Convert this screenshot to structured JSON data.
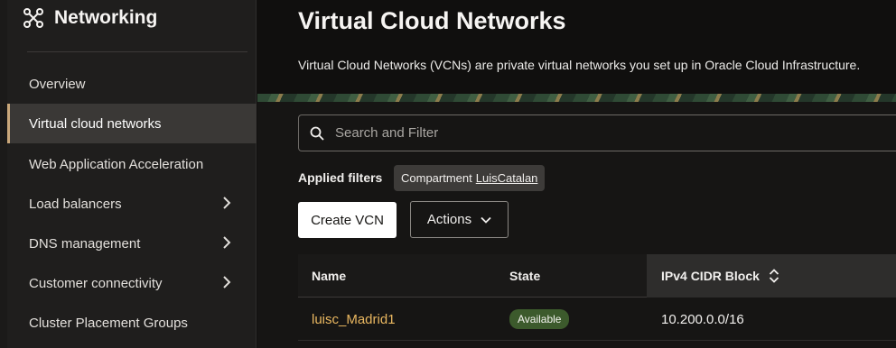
{
  "sidebar": {
    "title": "Networking",
    "items": [
      {
        "label": "Overview",
        "chevron": false,
        "active": false
      },
      {
        "label": "Virtual cloud networks",
        "chevron": false,
        "active": true
      },
      {
        "label": "Web Application Acceleration",
        "chevron": false,
        "active": false
      },
      {
        "label": "Load balancers",
        "chevron": true,
        "active": false
      },
      {
        "label": "DNS management",
        "chevron": true,
        "active": false
      },
      {
        "label": "Customer connectivity",
        "chevron": true,
        "active": false
      },
      {
        "label": "Cluster Placement Groups",
        "chevron": false,
        "active": false
      }
    ]
  },
  "header": {
    "title": "Virtual Cloud Networks",
    "description": "Virtual Cloud Networks (VCNs) are private virtual networks you set up in Oracle Cloud Infrastructure."
  },
  "search": {
    "placeholder": "Search and Filter",
    "value": ""
  },
  "filters": {
    "label": "Applied filters",
    "chip": {
      "key": "Compartment",
      "value": "LuisCatalan"
    }
  },
  "buttons": {
    "create": "Create VCN",
    "actions": "Actions"
  },
  "table": {
    "columns": [
      "Name",
      "State",
      "IPv4 CIDR Block"
    ],
    "rows": [
      {
        "name": "luisc_Madrid1",
        "state": "Available",
        "cidr": "10.200.0.0/16"
      }
    ]
  },
  "colors": {
    "accent": "#c9a77a",
    "link": "#e9b760",
    "status_available": "#3c5a2c"
  },
  "icons": [
    "networking-icon",
    "search-icon",
    "chevron-right-icon",
    "chevron-down-icon",
    "sort-icon"
  ]
}
